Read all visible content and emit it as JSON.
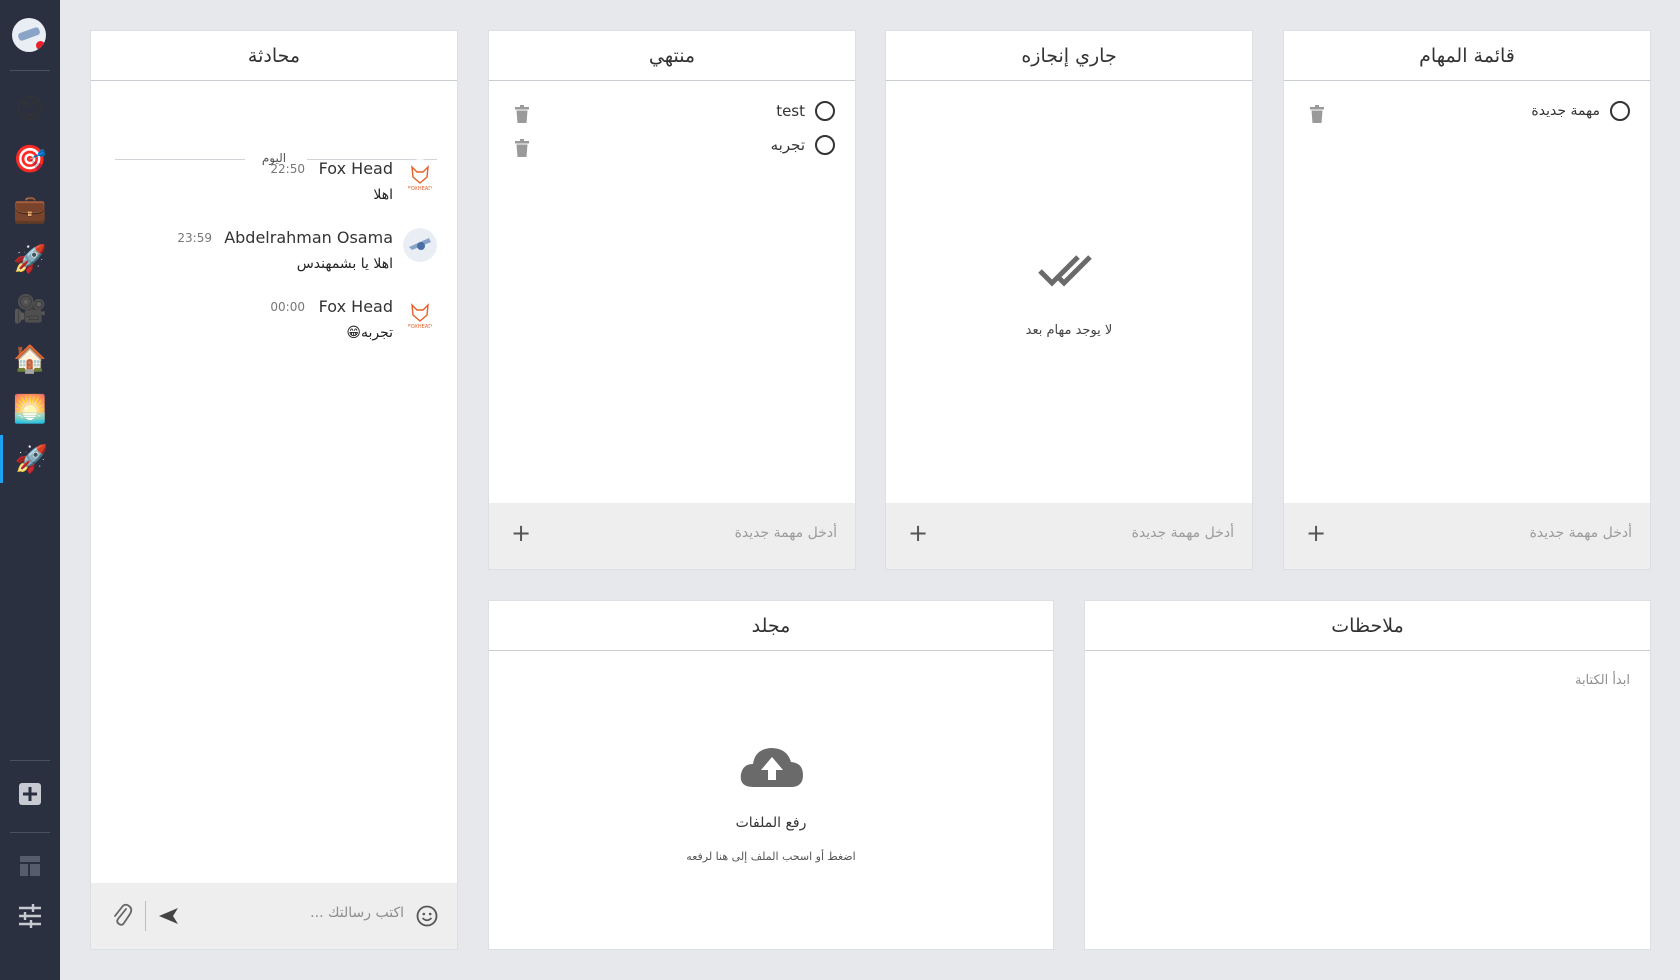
{
  "sidebar": {
    "apps": [
      {
        "icon": "smiley-icon",
        "glyph": "😊"
      },
      {
        "icon": "target-icon",
        "glyph": "🎯"
      },
      {
        "icon": "briefcase-icon",
        "glyph": "💼"
      },
      {
        "icon": "rocket-icon",
        "glyph": "🚀"
      },
      {
        "icon": "movie-camera-icon",
        "glyph": "🎥"
      },
      {
        "icon": "house-icon",
        "glyph": "🏠"
      },
      {
        "icon": "sunset-icon",
        "glyph": "🌅"
      },
      {
        "icon": "rocket-icon",
        "glyph": "🚀",
        "active": true
      }
    ],
    "tools": [
      "add-app-icon",
      "dashboard-layout-icon",
      "settings-sliders-icon"
    ]
  },
  "chat": {
    "title": "محادثة",
    "day_label": "اليوم",
    "messages": [
      {
        "sender": "Fox Head",
        "time": "22:50",
        "text": "اهلا"
      },
      {
        "sender": "Abdelrahman Osama",
        "time": "23:59",
        "text": "اهلا يا بشمهندس"
      },
      {
        "sender": "Fox Head",
        "time": "00:00",
        "text": "تجربه😁"
      }
    ],
    "avatar_caption": "FOXHEAD",
    "input_placeholder": "اكتب رسالتك ..."
  },
  "columns": {
    "todo": {
      "title": "قائمة المهام",
      "tasks": [
        "مهمة جديدة"
      ],
      "input_placeholder": "أدخل مهمة جديدة"
    },
    "in_progress": {
      "title": "جاري إنجازه",
      "empty_text": "لا يوجد مهام بعد",
      "input_placeholder": "أدخل مهمة جديدة"
    },
    "done": {
      "title": "منتهي",
      "tasks": [
        "test",
        "تجربه"
      ],
      "input_placeholder": "أدخل مهمة جديدة"
    }
  },
  "folder": {
    "title": "مجلد",
    "upload_title": "رفع الملفات",
    "upload_hint": "اضغط أو اسحب الملف إلى هنا لرفعه"
  },
  "notes": {
    "title": "ملاحظات",
    "placeholder": "ابدأ الكتابة"
  },
  "colors": {
    "sidebar_bg": "#2a3040",
    "active_accent": "#1da1f2",
    "page_bg": "#e6e8ec",
    "fox_orange": "#e8602a"
  }
}
